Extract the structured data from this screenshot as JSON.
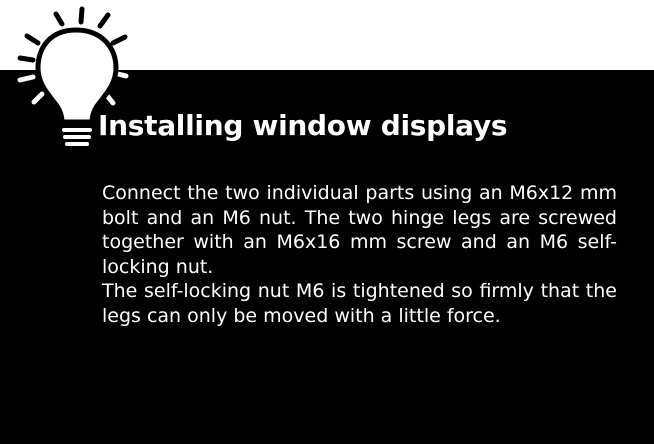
{
  "heading": "Installing window displays",
  "paragraphs": [
    "Connect the two individual parts using an M6x12 mm bolt and an M6 nut. The two hinge legs are screwed together with an M6x16 mm screw and an M6 self-locking nut.",
    "The self-locking nut M6 is tightened so firmly that the legs can only be moved with a little force."
  ],
  "icon": "lightbulb-idea-icon",
  "colors": {
    "panel": "#000000",
    "top_band": "#ffffff",
    "text": "#ffffff",
    "icon": "#ffffff"
  }
}
